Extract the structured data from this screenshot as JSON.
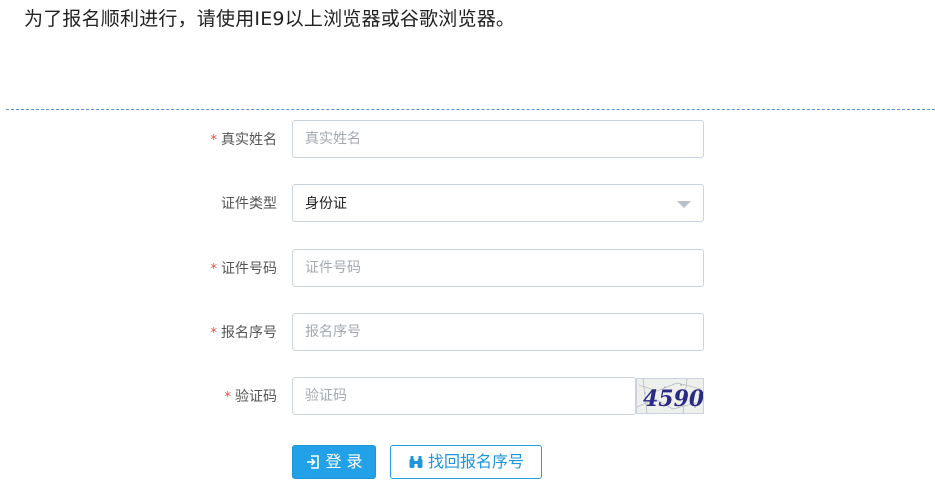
{
  "notice": "为了报名顺利进行，请使用IE9以上浏览器或谷歌浏览器。",
  "form": {
    "required_mark": "*",
    "name": {
      "label": "真实姓名",
      "placeholder": "真实姓名"
    },
    "id_type": {
      "label": "证件类型",
      "value": "身份证"
    },
    "id_number": {
      "label": "证件号码",
      "placeholder": "证件号码"
    },
    "serial": {
      "label": "报名序号",
      "placeholder": "报名序号"
    },
    "captcha": {
      "label": "验证码",
      "placeholder": "验证码",
      "image_text": "4590"
    }
  },
  "buttons": {
    "login": "登 录",
    "find_serial": "找回报名序号"
  },
  "icons": {
    "login": "login-icon",
    "find": "binoculars-icon",
    "select": "chevron-down-icon"
  },
  "colors": {
    "primary": "#22a0e8",
    "required": "#e8463a",
    "divider": "#5b8fd1"
  }
}
